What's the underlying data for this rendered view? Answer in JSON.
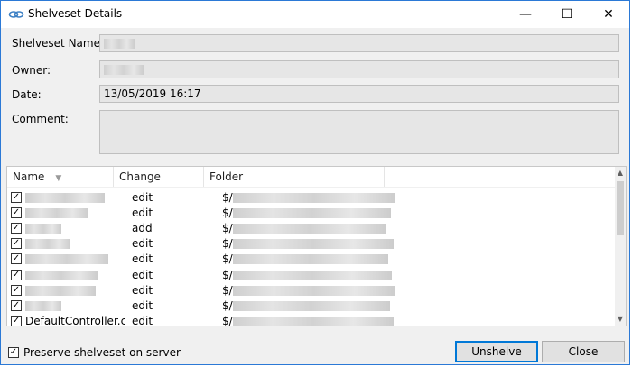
{
  "window": {
    "title": "Shelveset Details",
    "minimize_glyph": "—",
    "maximize_glyph": "☐",
    "close_glyph": "✕"
  },
  "form": {
    "name_label": "Shelveset Name:",
    "owner_label": "Owner:",
    "date_label": "Date:",
    "date_value": "13/05/2019 16:17",
    "comment_label": "Comment:"
  },
  "list": {
    "columns": [
      "Name",
      "Change",
      "Folder"
    ],
    "rows": [
      {
        "name": "",
        "change": "edit",
        "folder": "$/",
        "checked": true
      },
      {
        "name": "",
        "change": "edit",
        "folder": "$/",
        "checked": true
      },
      {
        "name": "",
        "change": "add",
        "folder": "$/",
        "checked": true
      },
      {
        "name": "",
        "change": "edit",
        "folder": "$/",
        "checked": true
      },
      {
        "name": "",
        "change": "edit",
        "folder": "$/",
        "checked": true
      },
      {
        "name": "",
        "change": "edit",
        "folder": "$/",
        "checked": true
      },
      {
        "name": "",
        "change": "edit",
        "folder": "$/",
        "checked": true
      },
      {
        "name": "",
        "change": "edit",
        "folder": "$/",
        "checked": true
      },
      {
        "name": "DefaultController.cs",
        "change": "edit",
        "folder": "$/",
        "checked": true
      }
    ]
  },
  "footer": {
    "preserve_label": "Preserve shelveset on server",
    "preserve_checked": true,
    "unshelve_label": "Unshelve",
    "close_label": "Close"
  },
  "icons": {
    "title_icon": "shelveset-icon",
    "check_glyph": "✓",
    "sort_glyph": "▼",
    "scroll_up": "▲",
    "scroll_down": "▼"
  },
  "colors": {
    "accent": "#0078d7",
    "window_border": "#2b79d6",
    "dialog_bg": "#f0f0f0",
    "field_bg": "#e6e6e6"
  }
}
